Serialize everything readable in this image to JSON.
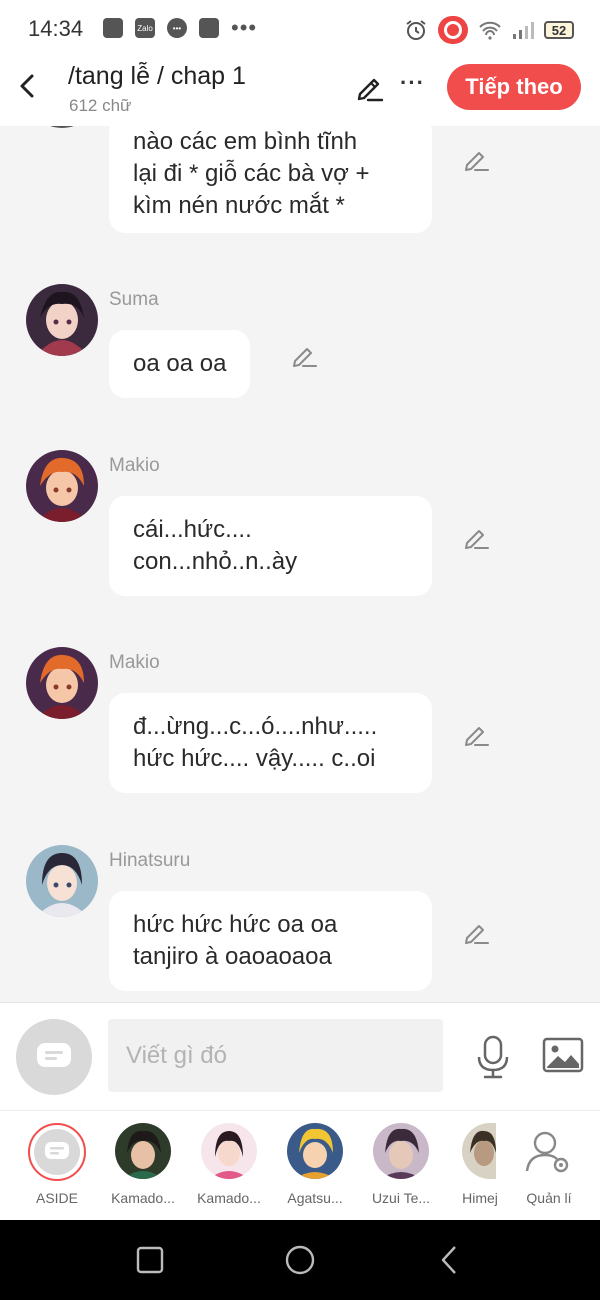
{
  "status_bar": {
    "time": "14:34",
    "battery": "52",
    "left_icons": [
      "screenshot-icon",
      "zalo-icon",
      "chat-bubble-icon",
      "gallery-icon",
      "more-dots-icon"
    ],
    "right_icons": [
      "alarm-icon",
      "screen-record-icon",
      "wifi-icon",
      "signal-icon",
      "battery-icon"
    ]
  },
  "header": {
    "title": "/tang lễ / chap 1",
    "subtitle": "612 chữ",
    "next_label": "Tiếp theo",
    "more_label": "···"
  },
  "messages": [
    {
      "speaker": "",
      "lines": [
        "nào các em bình tĩnh",
        "lại đi * giỗ các bà vợ +",
        "kìm nén nước mắt *"
      ]
    },
    {
      "speaker": "Suma",
      "lines": [
        "oa oa oa"
      ]
    },
    {
      "speaker": "Makio",
      "lines": [
        "cái...hức....",
        "con...nhỏ..n..ày"
      ]
    },
    {
      "speaker": "Makio",
      "lines": [
        "đ...ừng...c...ó....như.....",
        "hức hức.... vậy..... c..oi"
      ]
    },
    {
      "speaker": "Hinatsuru",
      "lines": [
        "hức hức hức oa oa",
        "tanjiro à oaoaoaoa"
      ]
    }
  ],
  "input": {
    "placeholder": "Viết gì đó",
    "value": ""
  },
  "characters": [
    {
      "label": "ASIDE"
    },
    {
      "label": "Kamado..."
    },
    {
      "label": "Kamado..."
    },
    {
      "label": "Agatsu..."
    },
    {
      "label": "Uzui Te..."
    },
    {
      "label": "Himej"
    },
    {
      "label": "Quản lí"
    }
  ],
  "colors": {
    "accent": "#f14d4d",
    "background": "#f4f4f4",
    "bubble": "#ffffff",
    "muted_text": "#999999"
  }
}
